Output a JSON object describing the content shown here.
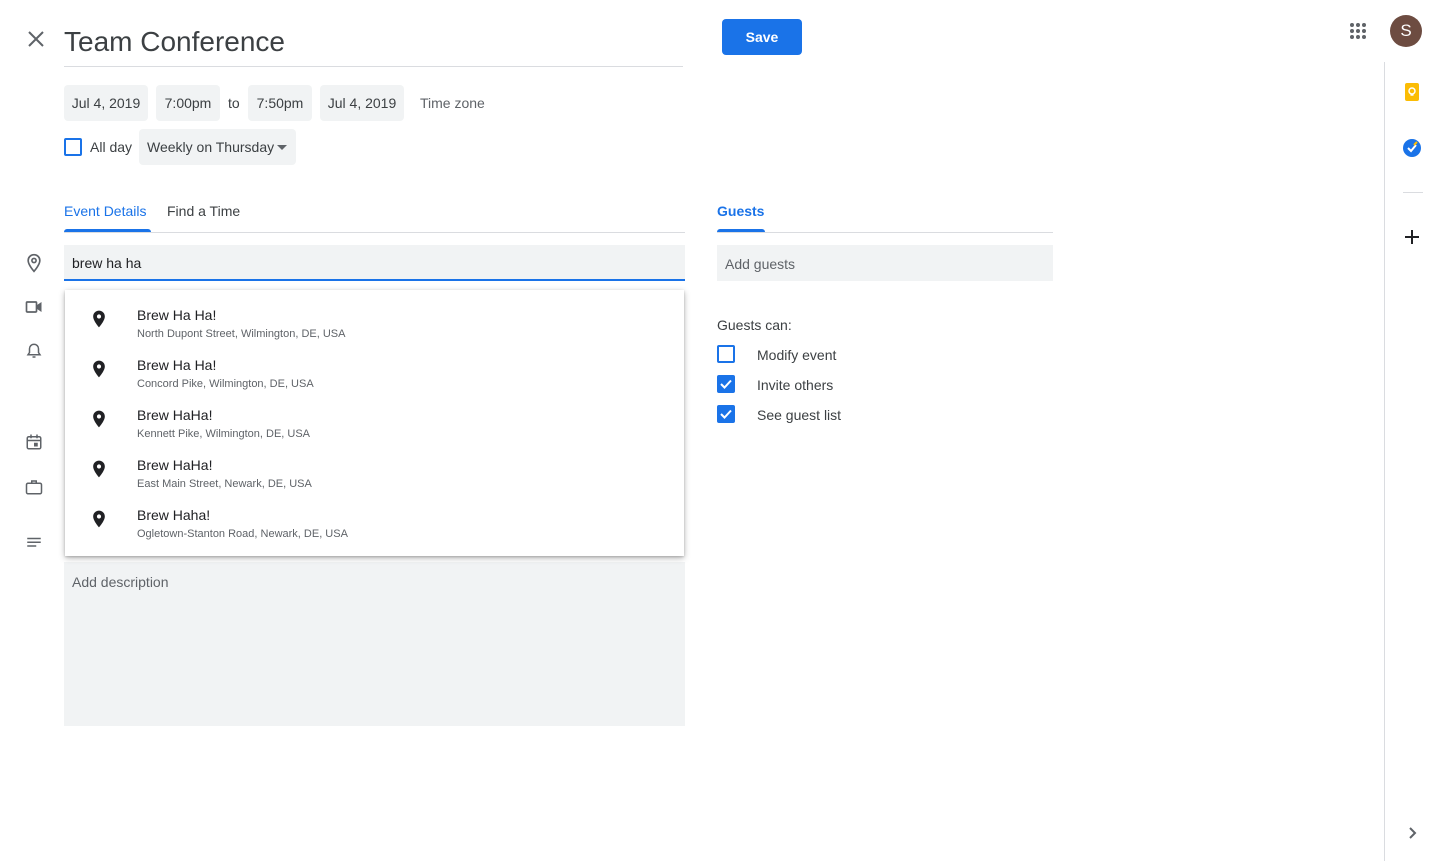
{
  "header": {
    "title": "Team Conference",
    "save_label": "Save",
    "avatar_letter": "S",
    "icons": {
      "close": "close-icon",
      "apps": "apps-grid-icon"
    }
  },
  "datetime": {
    "start_date": "Jul 4, 2019",
    "start_time": "7:00pm",
    "to_label": "to",
    "end_time": "7:50pm",
    "end_date": "Jul 4, 2019",
    "timezone_label": "Time zone"
  },
  "options": {
    "all_day_label": "All day",
    "all_day_checked": false,
    "repeat_value": "Weekly on Thursday"
  },
  "tabs": [
    {
      "label": "Event Details",
      "active": true
    },
    {
      "label": "Find a Time",
      "active": false
    }
  ],
  "location": {
    "value": "brew ha ha",
    "suggestions": [
      {
        "name": "Brew Ha Ha!",
        "address": "North Dupont Street, Wilmington, DE, USA"
      },
      {
        "name": "Brew Ha Ha!",
        "address": "Concord Pike, Wilmington, DE, USA"
      },
      {
        "name": "Brew HaHa!",
        "address": "Kennett Pike, Wilmington, DE, USA"
      },
      {
        "name": "Brew HaHa!",
        "address": "East Main Street, Newark, DE, USA"
      },
      {
        "name": "Brew Haha!",
        "address": "Ogletown-Stanton Road, Newark, DE, USA"
      }
    ]
  },
  "description": {
    "placeholder": "Add description"
  },
  "guests": {
    "tab_label": "Guests",
    "add_placeholder": "Add guests",
    "permissions_label": "Guests can:",
    "permissions": [
      {
        "label": "Modify event",
        "checked": false
      },
      {
        "label": "Invite others",
        "checked": true
      },
      {
        "label": "See guest list",
        "checked": true
      }
    ]
  },
  "side_icons": [
    "location-pin-icon",
    "video-icon",
    "bell-icon",
    "calendar-icon",
    "briefcase-icon",
    "notes-icon"
  ],
  "right_panel": {
    "icons": [
      "keep-icon",
      "tasks-icon",
      "add-icon",
      "chevron-right-icon"
    ]
  },
  "colors": {
    "accent": "#1a73e8",
    "field_bg": "#f1f3f4",
    "avatar_bg": "#6d4c41",
    "keep_yellow": "#fbbc04"
  }
}
